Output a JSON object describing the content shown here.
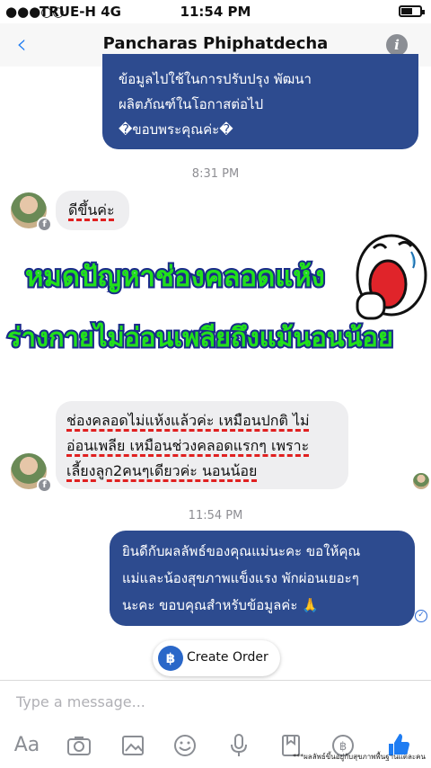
{
  "status_bar": {
    "signal": "●●●○○",
    "carrier": "TRUE-H  4G",
    "time": "11:54 PM",
    "battery_level": 0.6
  },
  "nav": {
    "back_glyph": "‹",
    "title": "Pancharas Phiphatdecha",
    "info_glyph": "i"
  },
  "messages": {
    "out_1": {
      "lines": [
        "ข้อมูลไปใช้ในการปรับปรุง พัฒนา",
        "ผลิตภัณฑ์ในโอกาสต่อไป",
        "�ขอบพระคุณค่ะ�"
      ]
    },
    "time_1": "8:31 PM",
    "in_1": "ดีขึ้นค่ะ",
    "in_2": {
      "lines": [
        "ช่องคลอดไม่แห้งแล้วค่ะ เหมือนปกติ ไม่",
        "อ่อนเพลีย เหมือนช่วงคลอดแรกๆ เพราะ",
        "เลี้ยงลูก2คนๆเดียวค่ะ นอนน้อย"
      ]
    },
    "time_2": "11:54 PM",
    "out_2": {
      "lines": [
        "ยินดีกับผลลัพธ์ของคุณแม่นะคะ ขอให้คุณ",
        "แม่และน้องสุขภาพแข็งแรง พักผ่อนเยอะๆ",
        "นะคะ ขอบคุณสำหรับข้อมูลค่ะ 🙏"
      ]
    }
  },
  "overlay": {
    "line_1": "หมดปัญหาช่องคลอดแห้ง",
    "line_2": "ร่างกายไม่อ่อนเพลียถึงแม้นอนน้อย"
  },
  "create_order": {
    "icon_glyph": "฿",
    "label": "Create Order"
  },
  "composer": {
    "placeholder": "Type a message...",
    "aa_label": "Aa",
    "footer_note": "***ผลลัพธ์ขึ้นอยู่กับสุขภาพพื้นฐานแต่ละคน"
  },
  "icons": [
    "text-format-icon",
    "camera-icon",
    "gallery-icon",
    "emoji-icon",
    "microphone-icon",
    "bookmark-icon",
    "payment-icon",
    "like-icon"
  ],
  "colors": {
    "accent": "#1e7cf2",
    "outgoing_bubble": "#2d4b8f",
    "incoming_bubble": "#eeeef0",
    "overlay_text": "#22e01c",
    "overlay_stroke": "#1a2a8a"
  }
}
